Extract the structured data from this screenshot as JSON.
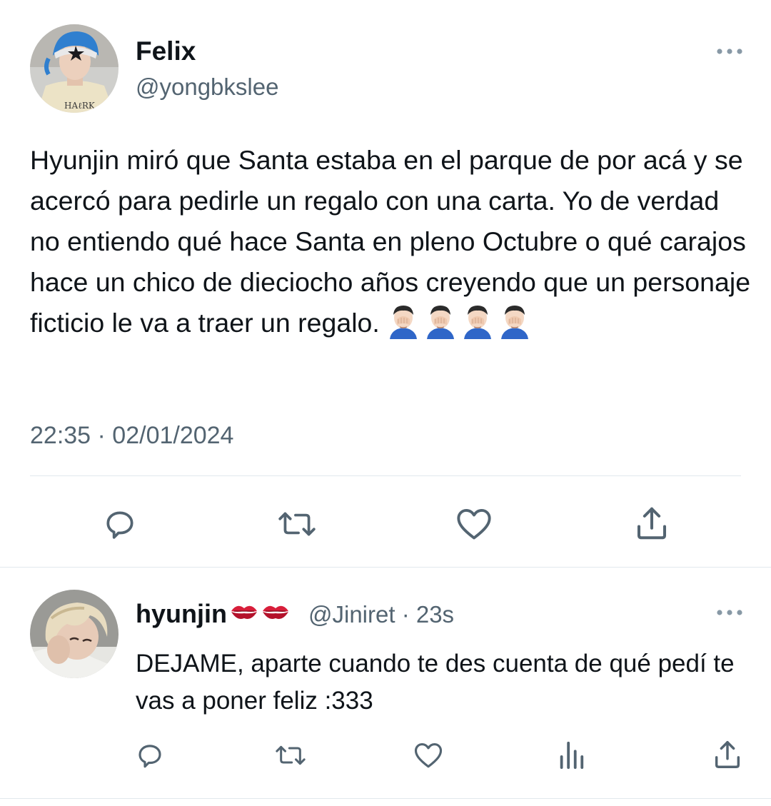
{
  "tweet": {
    "author_name": "Felix",
    "author_handle": "@yongbkslee",
    "text": "Hyunjin miró que Santa estaba en el parque de por acá y se acercó para pedirle un regalo con una carta. Yo de verdad no entiendo qué hace Santa en pleno Octubre o qué carajos hace un chico de dieciocho años creyendo que un personaje ficticio le va a traer un regalo.",
    "emoji_count": 4,
    "emoji_name": "person-facepalming-emoji",
    "timestamp": "22:35 · 02/01/2024",
    "actions": [
      "reply-icon",
      "retweet-icon",
      "like-icon",
      "share-icon"
    ]
  },
  "reply": {
    "author_name": "hyunjin",
    "author_emoji_name": "kiss-mark-emoji",
    "author_emoji_count": 2,
    "author_handle_time": "@Jiniret · 23s",
    "text": "DEJAME, aparte cuando te des cuenta de qué pedí te vas a poner feliz :333",
    "actions": [
      "reply-icon",
      "retweet-icon",
      "like-icon",
      "views-icon",
      "share-icon"
    ]
  },
  "colors": {
    "text": "#0f1419",
    "secondary": "#536471",
    "divider": "#e1e8ed",
    "kiss": "#d81e3a"
  }
}
